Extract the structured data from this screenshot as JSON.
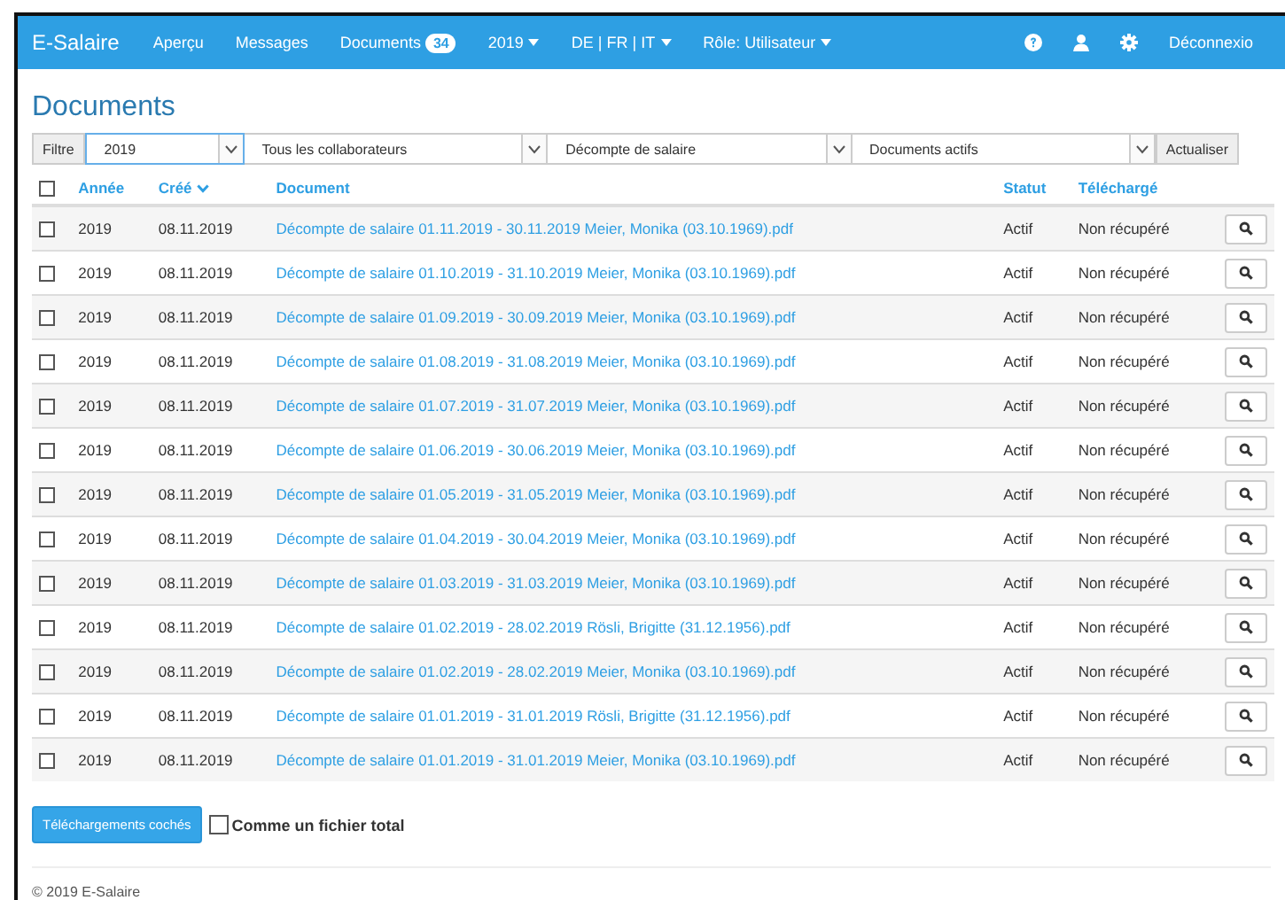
{
  "navbar": {
    "brand": "E-Salaire",
    "items": [
      {
        "label": "Aperçu",
        "kind": "link"
      },
      {
        "label": "Messages",
        "kind": "link"
      },
      {
        "label": "Documents",
        "kind": "badge",
        "badge": "34"
      },
      {
        "label": "2019",
        "kind": "dropdown"
      },
      {
        "label": "DE | FR | IT",
        "kind": "dropdown"
      },
      {
        "label": "Rôle: Utilisateur",
        "kind": "dropdown"
      }
    ],
    "logout": "Déconnexio"
  },
  "page_title": "Documents",
  "filter": {
    "label": "Filtre",
    "selects": [
      "2019",
      "Tous les collaborateurs",
      "Décompte de salaire",
      "Documents actifs"
    ],
    "button": "Actualiser"
  },
  "table": {
    "header_checked": false,
    "columns": [
      {
        "label": "Année",
        "sorted": false
      },
      {
        "label": "Créé",
        "sorted": true
      },
      {
        "label": "Document",
        "sorted": false
      },
      {
        "label": "Statut",
        "sorted": false
      },
      {
        "label": "Téléchargé",
        "sorted": false
      }
    ],
    "rows": [
      {
        "checked": false,
        "year": "2019",
        "created": "08.11.2019",
        "document": "Décompte de salaire 01.11.2019 - 30.11.2019 Meier, Monika (03.10.1969).pdf",
        "status": "Actif",
        "downloaded": "Non récupéré"
      },
      {
        "checked": false,
        "year": "2019",
        "created": "08.11.2019",
        "document": "Décompte de salaire 01.10.2019 - 31.10.2019 Meier, Monika (03.10.1969).pdf",
        "status": "Actif",
        "downloaded": "Non récupéré"
      },
      {
        "checked": false,
        "year": "2019",
        "created": "08.11.2019",
        "document": "Décompte de salaire 01.09.2019 - 30.09.2019 Meier, Monika (03.10.1969).pdf",
        "status": "Actif",
        "downloaded": "Non récupéré"
      },
      {
        "checked": false,
        "year": "2019",
        "created": "08.11.2019",
        "document": "Décompte de salaire 01.08.2019 - 31.08.2019 Meier, Monika (03.10.1969).pdf",
        "status": "Actif",
        "downloaded": "Non récupéré"
      },
      {
        "checked": false,
        "year": "2019",
        "created": "08.11.2019",
        "document": "Décompte de salaire 01.07.2019 - 31.07.2019 Meier, Monika (03.10.1969).pdf",
        "status": "Actif",
        "downloaded": "Non récupéré"
      },
      {
        "checked": false,
        "year": "2019",
        "created": "08.11.2019",
        "document": "Décompte de salaire 01.06.2019 - 30.06.2019 Meier, Monika (03.10.1969).pdf",
        "status": "Actif",
        "downloaded": "Non récupéré"
      },
      {
        "checked": false,
        "year": "2019",
        "created": "08.11.2019",
        "document": "Décompte de salaire 01.05.2019 - 31.05.2019 Meier, Monika (03.10.1969).pdf",
        "status": "Actif",
        "downloaded": "Non récupéré"
      },
      {
        "checked": false,
        "year": "2019",
        "created": "08.11.2019",
        "document": "Décompte de salaire 01.04.2019 - 30.04.2019 Meier, Monika (03.10.1969).pdf",
        "status": "Actif",
        "downloaded": "Non récupéré"
      },
      {
        "checked": false,
        "year": "2019",
        "created": "08.11.2019",
        "document": "Décompte de salaire 01.03.2019 - 31.03.2019 Meier, Monika (03.10.1969).pdf",
        "status": "Actif",
        "downloaded": "Non récupéré"
      },
      {
        "checked": false,
        "year": "2019",
        "created": "08.11.2019",
        "document": "Décompte de salaire 01.02.2019 - 28.02.2019 Rösli, Brigitte (31.12.1956).pdf",
        "status": "Actif",
        "downloaded": "Non récupéré"
      },
      {
        "checked": false,
        "year": "2019",
        "created": "08.11.2019",
        "document": "Décompte de salaire 01.02.2019 - 28.02.2019 Meier, Monika (03.10.1969).pdf",
        "status": "Actif",
        "downloaded": "Non récupéré"
      },
      {
        "checked": false,
        "year": "2019",
        "created": "08.11.2019",
        "document": "Décompte de salaire 01.01.2019 - 31.01.2019 Rösli, Brigitte (31.12.1956).pdf",
        "status": "Actif",
        "downloaded": "Non récupéré"
      },
      {
        "checked": false,
        "year": "2019",
        "created": "08.11.2019",
        "document": "Décompte de salaire 01.01.2019 - 31.01.2019 Meier, Monika (03.10.1969).pdf",
        "status": "Actif",
        "downloaded": "Non récupéré"
      }
    ]
  },
  "footer_actions": {
    "button": "Téléchargements cochés",
    "checkbox": {
      "label": "Comme un fichier total",
      "checked": false
    }
  },
  "copyright": "© 2019 E-Salaire"
}
